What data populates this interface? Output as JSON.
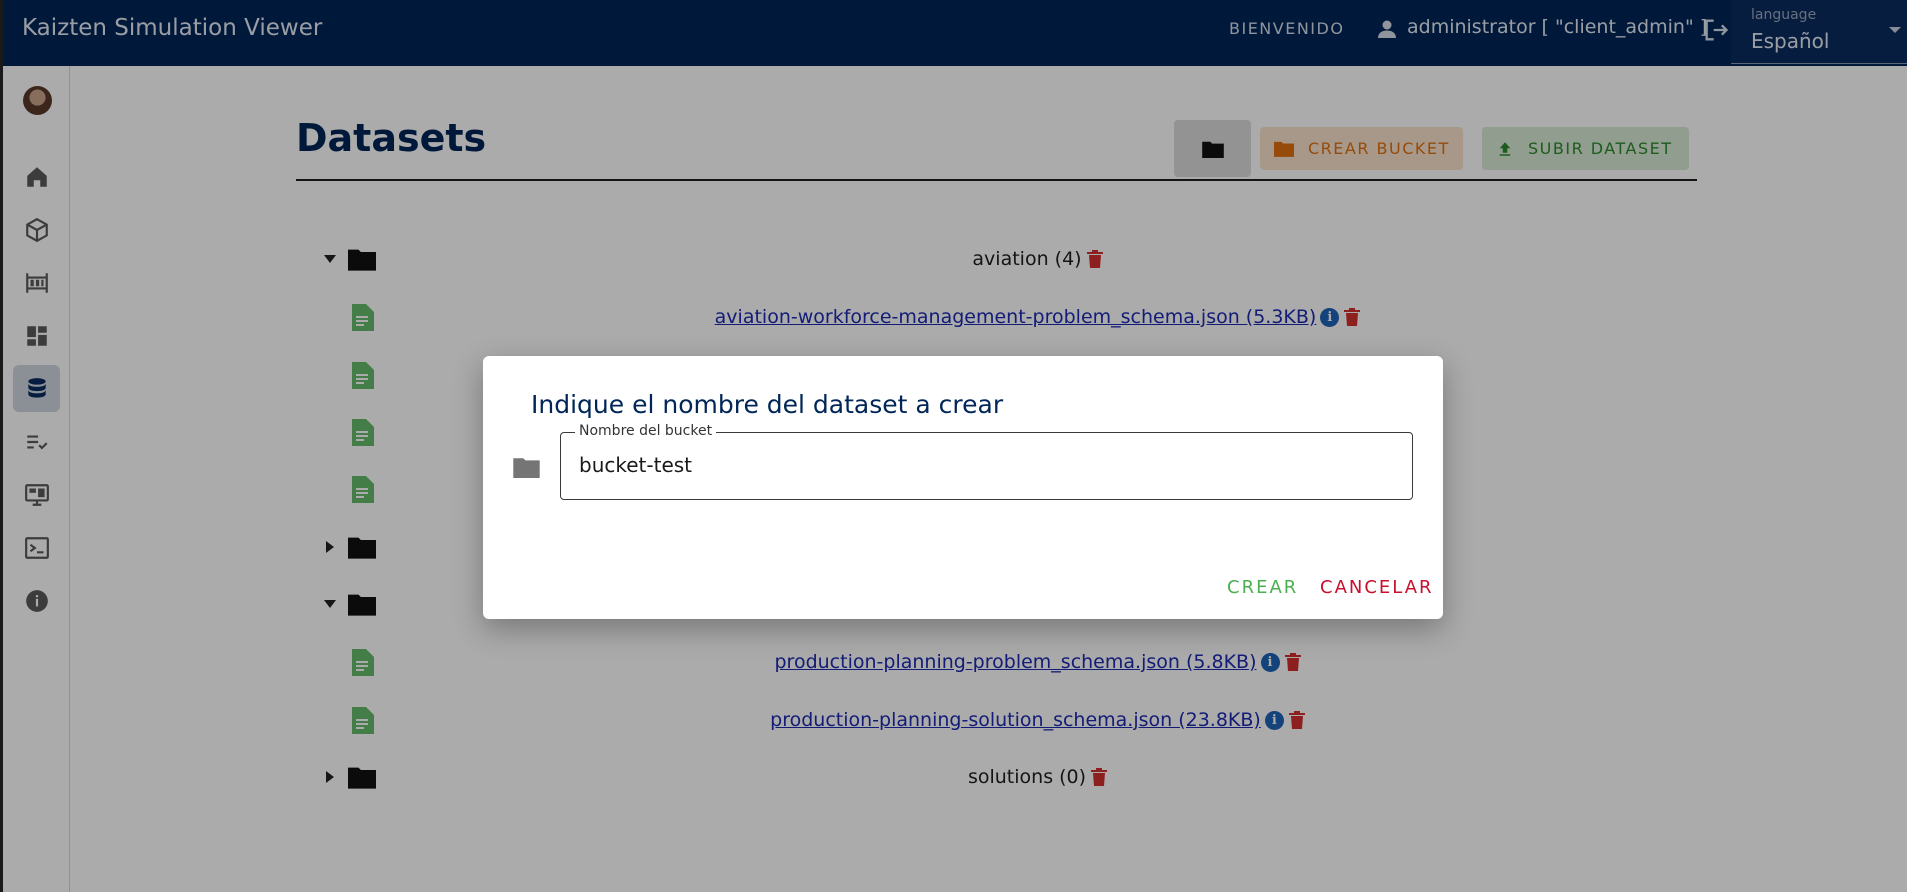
{
  "header": {
    "app_title": "Kaizten Simulation Viewer",
    "welcome": "BIENVENIDO",
    "user": "administrator [ \"client_admin\" ]",
    "language_label": "language",
    "language_value": "Español"
  },
  "sidebar": {
    "items": [
      {
        "name": "home-icon"
      },
      {
        "name": "cube-icon"
      },
      {
        "name": "abacus-icon"
      },
      {
        "name": "dashboard-icon"
      },
      {
        "name": "database-icon",
        "active": true
      },
      {
        "name": "checklist-icon"
      },
      {
        "name": "monitor-icon"
      },
      {
        "name": "terminal-icon"
      },
      {
        "name": "info-icon"
      }
    ]
  },
  "main": {
    "title": "Datasets",
    "buttons": {
      "crear_bucket": "CREAR BUCKET",
      "subir_dataset": "SUBIR DATASET"
    },
    "tree": [
      {
        "type": "folder",
        "expanded": true,
        "label": "aviation (4)"
      },
      {
        "type": "file",
        "label": "aviation-workforce-management-problem_schema.json (5.3KB)"
      },
      {
        "type": "file",
        "label": ""
      },
      {
        "type": "file",
        "label": ""
      },
      {
        "type": "file",
        "label": ""
      },
      {
        "type": "folder",
        "expanded": false,
        "label": ""
      },
      {
        "type": "folder",
        "expanded": true,
        "label": ""
      },
      {
        "type": "file",
        "label": "production-planning-problem_schema.json (5.8KB)"
      },
      {
        "type": "file",
        "label": "production-planning-solution_schema.json (23.8KB)"
      },
      {
        "type": "folder",
        "expanded": false,
        "label": "solutions (0)"
      }
    ]
  },
  "dialog": {
    "title": "Indique el nombre del dataset a crear",
    "field_label": "Nombre del bucket",
    "field_value": "bucket-test",
    "crear": "CREAR",
    "cancelar": "CANCELAR"
  },
  "colors": {
    "header_bg": "#002557",
    "accent_orange": "#e0700f",
    "accent_green": "#2c8a2c",
    "danger": "#c8102e",
    "link": "#1d2bb0"
  }
}
